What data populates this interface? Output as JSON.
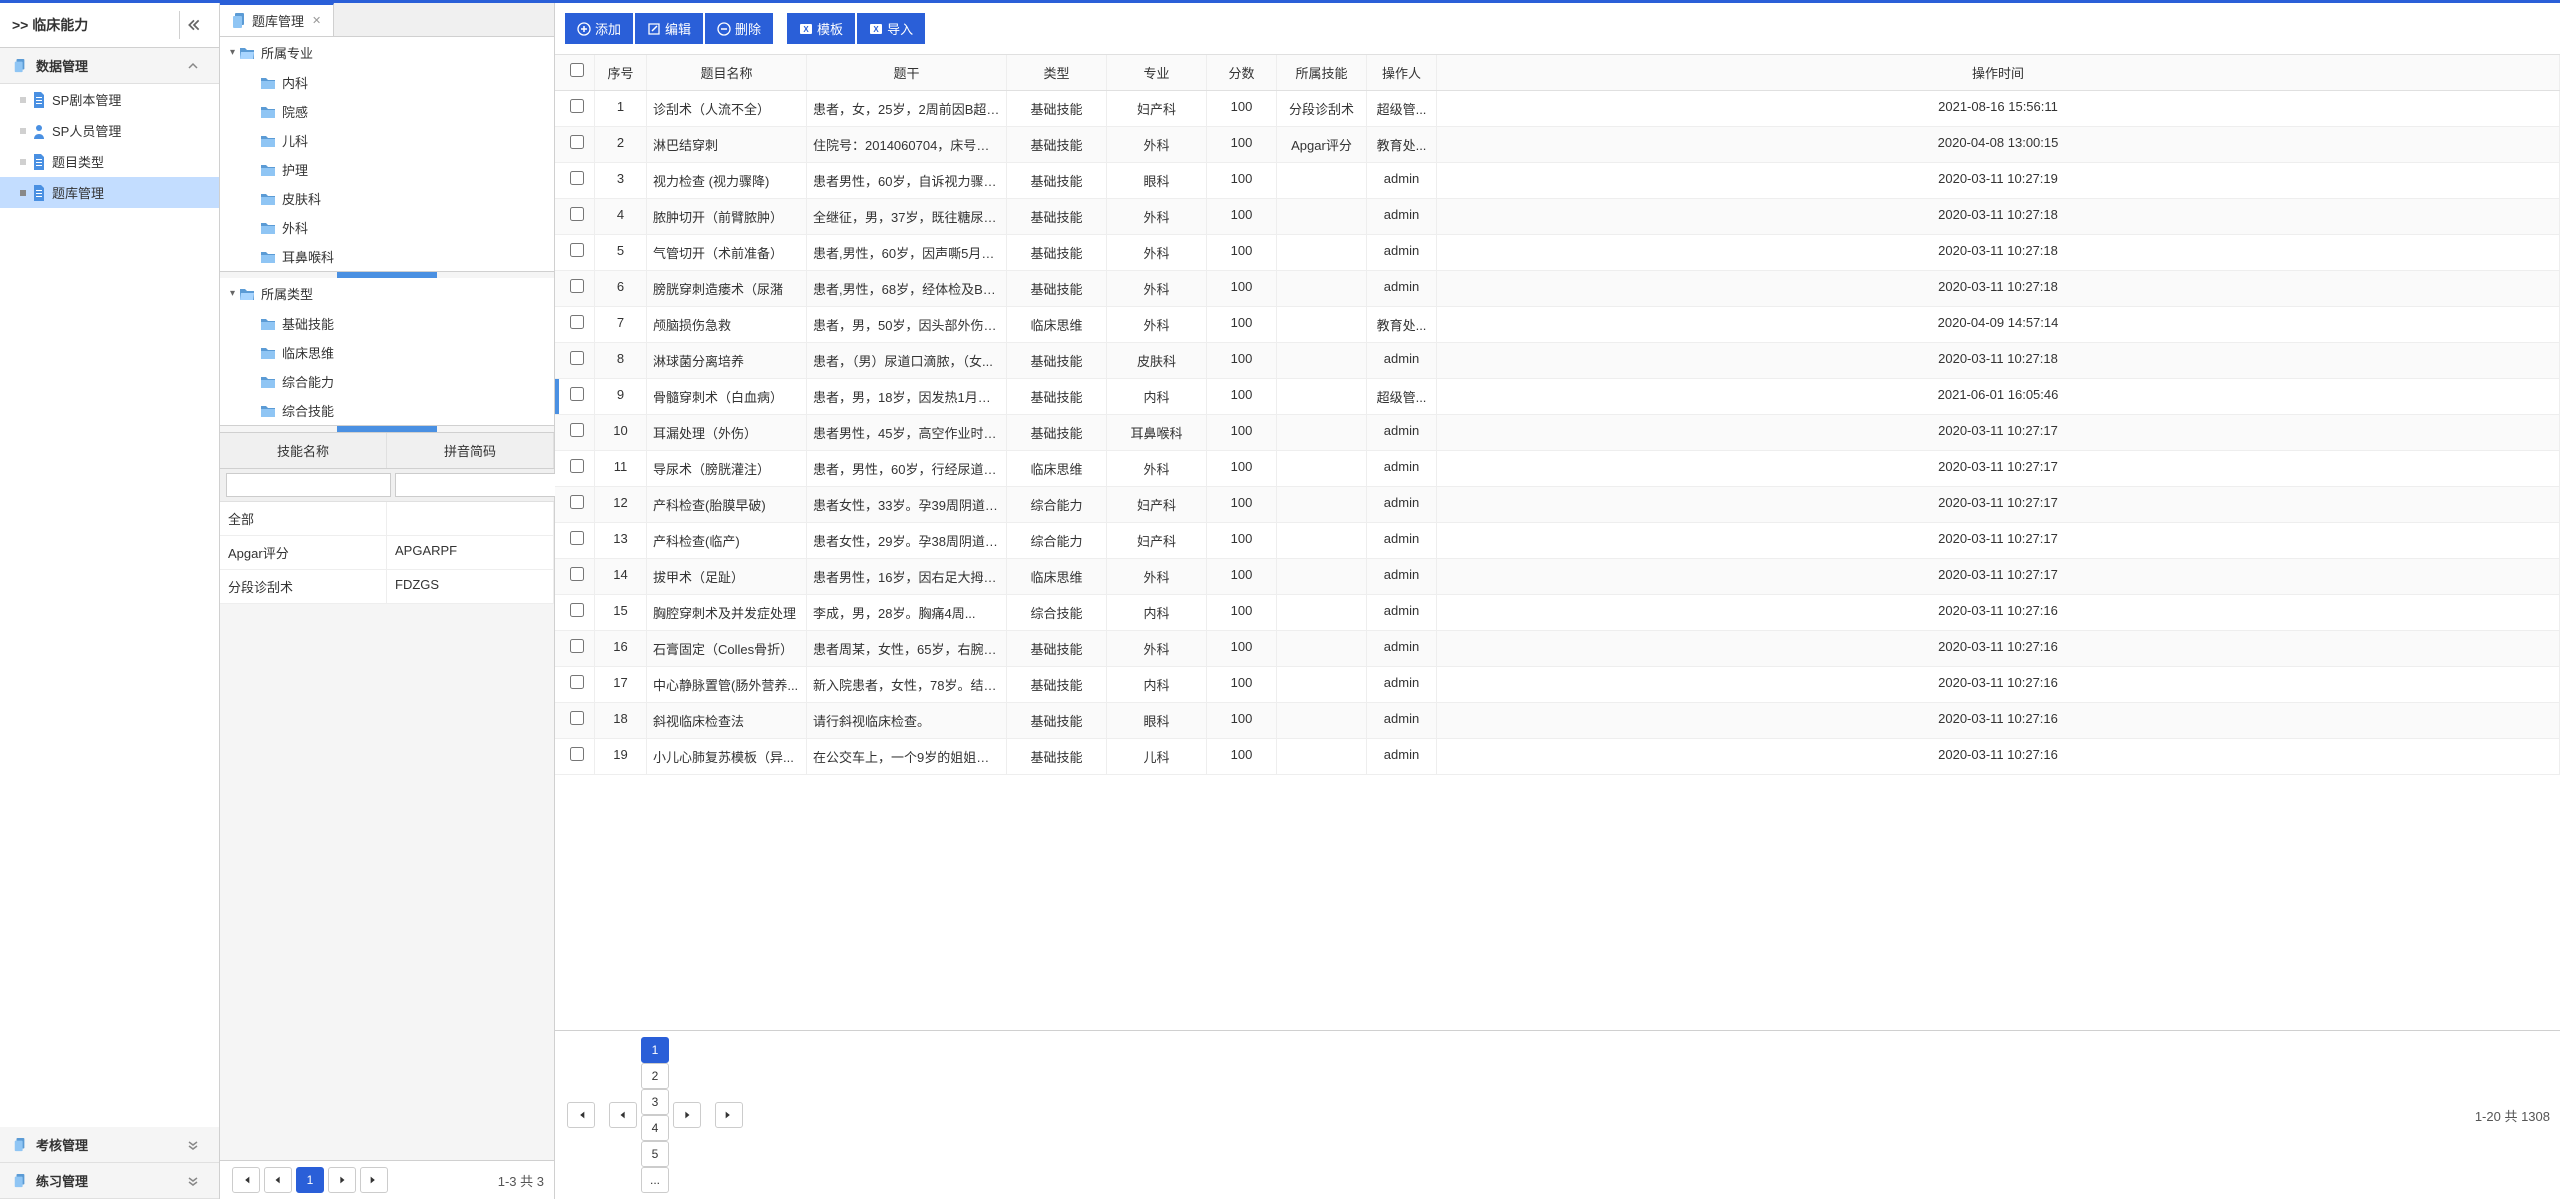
{
  "leftNav": {
    "title": ">>  临床能力",
    "sections": [
      {
        "title": "数据管理",
        "expanded": true,
        "items": [
          {
            "label": "SP剧本管理",
            "icon": "doc",
            "color": "#4a90e2"
          },
          {
            "label": "SP人员管理",
            "icon": "user",
            "color": "#4a90e2"
          },
          {
            "label": "题目类型",
            "icon": "doc",
            "color": "#4a90e2"
          },
          {
            "label": "题库管理",
            "icon": "doc",
            "color": "#4a90e2",
            "active": true
          }
        ]
      },
      {
        "title": "考核管理",
        "expanded": false
      },
      {
        "title": "练习管理",
        "expanded": false
      }
    ]
  },
  "tabs": [
    {
      "label": "题库管理",
      "active": true
    }
  ],
  "trees": [
    {
      "title": "所属专业",
      "items": [
        "内科",
        "院感",
        "儿科",
        "护理",
        "皮肤科",
        "外科",
        "耳鼻喉科"
      ]
    },
    {
      "title": "所属类型",
      "items": [
        "基础技能",
        "临床思维",
        "综合能力",
        "综合技能"
      ]
    }
  ],
  "skillTable": {
    "headers": [
      "技能名称",
      "拼音简码"
    ],
    "rows": [
      {
        "name": "全部",
        "code": ""
      },
      {
        "name": "Apgar评分",
        "code": "APGARPF"
      },
      {
        "name": "分段诊刮术",
        "code": "FDZGS"
      }
    ]
  },
  "skillPagination": {
    "current": 1,
    "info": "1-3 共 3"
  },
  "toolbar": {
    "add": "添加",
    "edit": "编辑",
    "delete": "删除",
    "template": "模板",
    "import": "导入"
  },
  "mainTable": {
    "headers": {
      "seq": "序号",
      "name": "题目名称",
      "stem": "题干",
      "type": "类型",
      "major": "专业",
      "score": "分数",
      "skill": "所属技能",
      "oper": "操作人",
      "time": "操作时间"
    },
    "rows": [
      {
        "seq": 1,
        "name": "诊刮术（人流不全）",
        "stem": "患者，女，25岁，2周前因B超提...",
        "type": "基础技能",
        "major": "妇产科",
        "score": 100,
        "skill": "分段诊刮术",
        "oper": "超级管...",
        "time": "2021-08-16 15:56:11"
      },
      {
        "seq": 2,
        "name": "淋巴结穿刺",
        "stem": "住院号：2014060704，床号：1...",
        "type": "基础技能",
        "major": "外科",
        "score": 100,
        "skill": "Apgar评分",
        "oper": "教育处...",
        "time": "2020-04-08 13:00:15"
      },
      {
        "seq": 3,
        "name": "视力检查 (视力骤降)",
        "stem": "患者男性，60岁，自诉视力骤降...",
        "type": "基础技能",
        "major": "眼科",
        "score": 100,
        "skill": "",
        "oper": "admin",
        "time": "2020-03-11 10:27:19"
      },
      {
        "seq": 4,
        "name": "脓肿切开（前臂脓肿）",
        "stem": "全继征，男，37岁，既往糖尿病...",
        "type": "基础技能",
        "major": "外科",
        "score": 100,
        "skill": "",
        "oper": "admin",
        "time": "2020-03-11 10:27:18"
      },
      {
        "seq": 5,
        "name": "气管切开（术前准备）",
        "stem": "患者,男性，60岁，因声嘶5月就...",
        "type": "基础技能",
        "major": "外科",
        "score": 100,
        "skill": "",
        "oper": "admin",
        "time": "2020-03-11 10:27:18"
      },
      {
        "seq": 6,
        "name": "膀胱穿刺造瘘术（尿潴",
        "stem": "患者,男性，68岁，经体检及B超...",
        "type": "基础技能",
        "major": "外科",
        "score": 100,
        "skill": "",
        "oper": "admin",
        "time": "2020-03-11 10:27:18"
      },
      {
        "seq": 7,
        "name": "颅脑损伤急救",
        "stem": "患者，男，50岁，因头部外伤就...",
        "type": "临床思维",
        "major": "外科",
        "score": 100,
        "skill": "",
        "oper": "教育处...",
        "time": "2020-04-09 14:57:14"
      },
      {
        "seq": 8,
        "name": "淋球菌分离培养",
        "stem": "患者，（男）尿道口滴脓，（女...",
        "type": "基础技能",
        "major": "皮肤科",
        "score": 100,
        "skill": "",
        "oper": "admin",
        "time": "2020-03-11 10:27:18"
      },
      {
        "seq": 9,
        "name": "骨髓穿刺术（白血病）",
        "stem": "患者，男，18岁，因发热1月入...",
        "type": "基础技能",
        "major": "内科",
        "score": 100,
        "skill": "",
        "oper": "超级管...",
        "time": "2021-06-01 16:05:46",
        "highlight": true
      },
      {
        "seq": 10,
        "name": "耳漏处理（外伤）",
        "stem": "患者男性，45岁，高空作业时有...",
        "type": "基础技能",
        "major": "耳鼻喉科",
        "score": 100,
        "skill": "",
        "oper": "admin",
        "time": "2020-03-11 10:27:17"
      },
      {
        "seq": 11,
        "name": "导尿术（膀胱灌注）",
        "stem": "患者，男性，60岁，行经尿道膀...",
        "type": "临床思维",
        "major": "外科",
        "score": 100,
        "skill": "",
        "oper": "admin",
        "time": "2020-03-11 10:27:17"
      },
      {
        "seq": 12,
        "name": "产科检查(胎膜早破)",
        "stem": "患者女性，33岁。孕39周阴道流...",
        "type": "综合能力",
        "major": "妇产科",
        "score": 100,
        "skill": "",
        "oper": "admin",
        "time": "2020-03-11 10:27:17"
      },
      {
        "seq": 13,
        "name": "产科检查(临产)",
        "stem": "患者女性，29岁。孕38周阴道见...",
        "type": "综合能力",
        "major": "妇产科",
        "score": 100,
        "skill": "",
        "oper": "admin",
        "time": "2020-03-11 10:27:17"
      },
      {
        "seq": 14,
        "name": "拔甲术（足趾）",
        "stem": "患者男性，16岁，因右足大拇趾...",
        "type": "临床思维",
        "major": "外科",
        "score": 100,
        "skill": "",
        "oper": "admin",
        "time": "2020-03-11 10:27:17"
      },
      {
        "seq": 15,
        "name": "胸腔穿刺术及并发症处理",
        "stem": "  李成，男，28岁。胸痛4周...",
        "type": "综合技能",
        "major": "内科",
        "score": 100,
        "skill": "",
        "oper": "admin",
        "time": "2020-03-11 10:27:16"
      },
      {
        "seq": 16,
        "name": "石膏固定（Colles骨折）",
        "stem": "患者周某，女性，65岁，右腕外...",
        "type": "基础技能",
        "major": "外科",
        "score": 100,
        "skill": "",
        "oper": "admin",
        "time": "2020-03-11 10:27:16"
      },
      {
        "seq": 17,
        "name": "中心静脉置管(肠外营养...",
        "stem": "新入院患者，女性，78岁。结肠...",
        "type": "基础技能",
        "major": "内科",
        "score": 100,
        "skill": "",
        "oper": "admin",
        "time": "2020-03-11 10:27:16"
      },
      {
        "seq": 18,
        "name": "斜视临床检查法",
        "stem": "请行斜视临床检查。",
        "type": "基础技能",
        "major": "眼科",
        "score": 100,
        "skill": "",
        "oper": "admin",
        "time": "2020-03-11 10:27:16"
      },
      {
        "seq": 19,
        "name": "小儿心肺复苏模板（异...",
        "stem": "在公交车上，一个9岁的姐姐给5...",
        "type": "基础技能",
        "major": "儿科",
        "score": 100,
        "skill": "",
        "oper": "admin",
        "time": "2020-03-11 10:27:16"
      }
    ]
  },
  "mainPagination": {
    "pages": [
      "1",
      "2",
      "3",
      "4",
      "5",
      "..."
    ],
    "current": 1,
    "info": "1-20 共 1308"
  }
}
